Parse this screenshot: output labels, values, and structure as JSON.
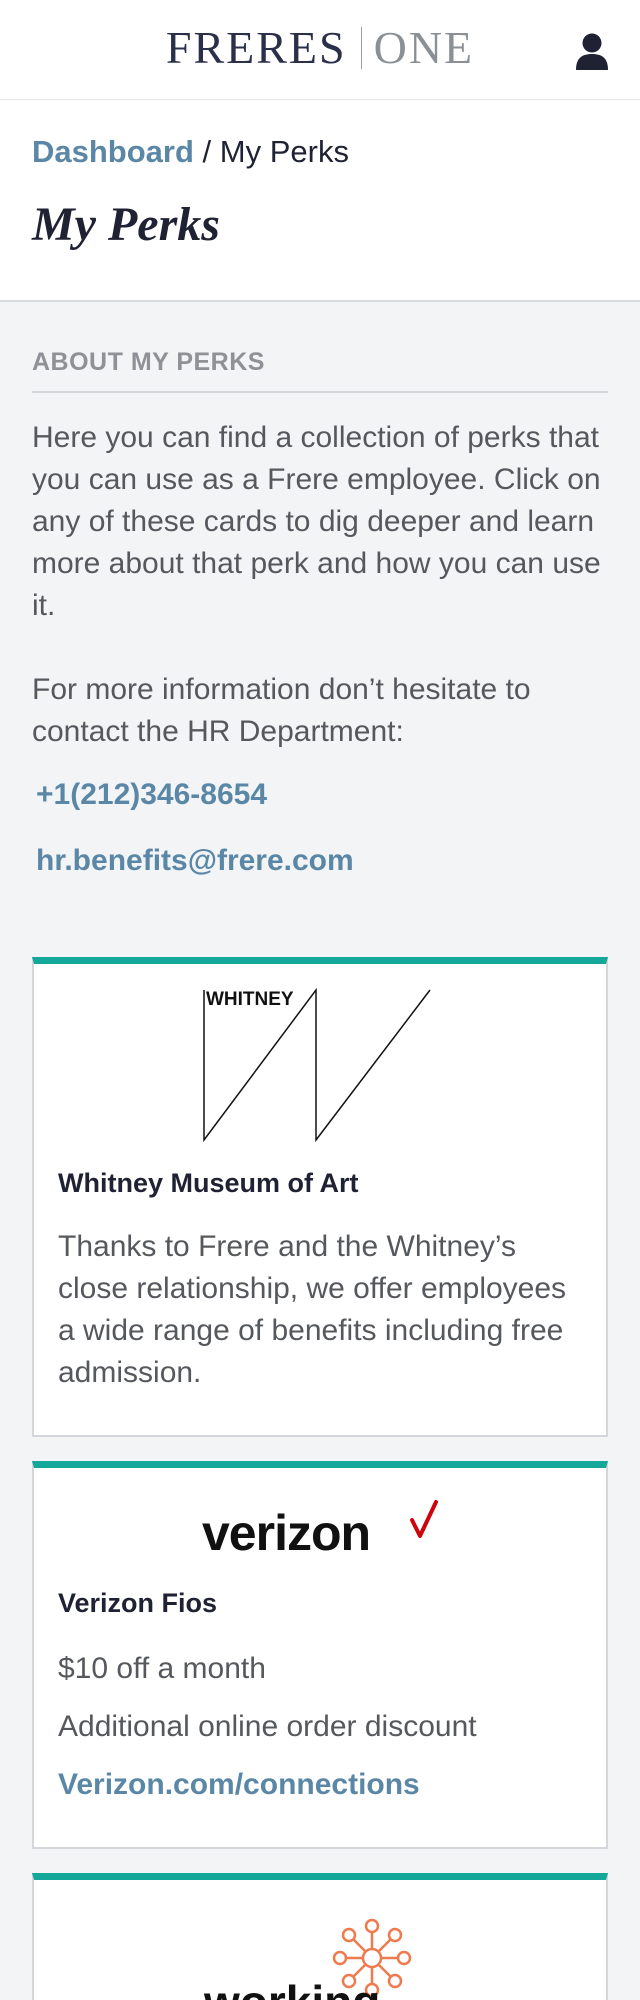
{
  "header": {
    "brand_primary": "FRERES",
    "brand_secondary": "ONE",
    "user_icon": "user-icon"
  },
  "breadcrumb": {
    "home": "Dashboard",
    "separator": " / ",
    "current": "My Perks"
  },
  "page_title": "My Perks",
  "about": {
    "heading": "ABOUT MY PERKS",
    "paragraph1": "Here you can find a collection of perks that you can use as a Frere employee. Click on any of these cards to dig deeper and learn more about that perk and how you can use it.",
    "paragraph2": "For more information don’t hesitate to contact the HR Department:",
    "phone": "+1(212)346-8654",
    "email": "hr.benefits@frere.com"
  },
  "cards": [
    {
      "logo_text": "WHITNEY",
      "title": "Whitney Museum of Art",
      "description": "Thanks to Frere and the Whitney’s close relationship, we offer employees a wide range of benefits including free admission."
    },
    {
      "logo_text": "verizon",
      "title": "Verizon Fios",
      "line1": "$10 off a month",
      "line2": "Additional online order discount",
      "link": "Verizon.com/connections"
    },
    {
      "logo_text": "working"
    }
  ],
  "colors": {
    "accent_link": "#5b87a6",
    "card_top_border": "#14a89a",
    "verizon_check": "#cd040b",
    "working_logo": "#ee7a4e",
    "brand_navy": "#2a2f4a"
  }
}
